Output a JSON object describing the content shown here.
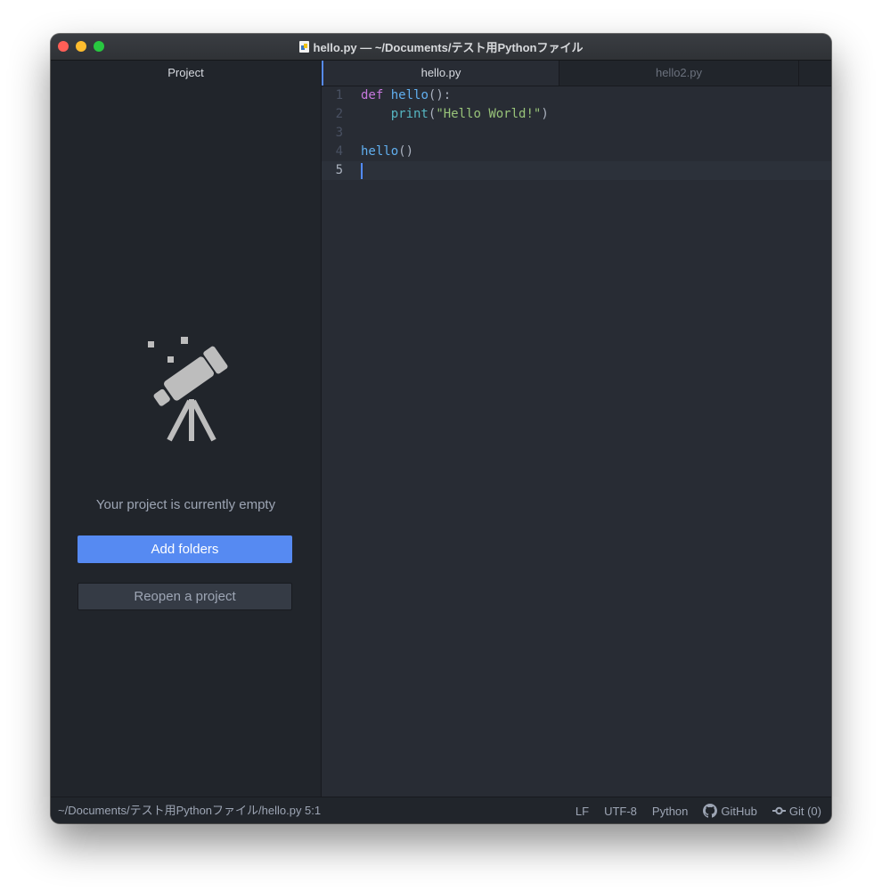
{
  "window": {
    "title": "hello.py — ~/Documents/テスト用Pythonファイル"
  },
  "sidebar": {
    "tab_label": "Project",
    "empty_message": "Your project is currently empty",
    "add_folders_label": "Add folders",
    "reopen_label": "Reopen a project"
  },
  "tabs": [
    {
      "label": "hello.py",
      "active": true
    },
    {
      "label": "hello2.py",
      "active": false
    }
  ],
  "editor": {
    "language": "Python",
    "lines": [
      {
        "number": "1",
        "code": "def hello():"
      },
      {
        "number": "2",
        "code": "    print(\"Hello World!\")"
      },
      {
        "number": "3",
        "code": ""
      },
      {
        "number": "4",
        "code": "hello()"
      },
      {
        "number": "5",
        "code": ""
      }
    ],
    "current_line": 5
  },
  "status": {
    "file_path": "~/Documents/テスト用Pythonファイル/hello.py",
    "cursor_position": "5:1",
    "line_ending": "LF",
    "encoding": "UTF-8",
    "grammar": "Python",
    "github_label": "GitHub",
    "git_label": "Git (0)"
  },
  "colors": {
    "accent": "#568af2",
    "editor_bg": "#282c34",
    "panel_bg": "#21252b",
    "keyword": "#c678dd",
    "function": "#61afef",
    "string": "#98c379"
  }
}
